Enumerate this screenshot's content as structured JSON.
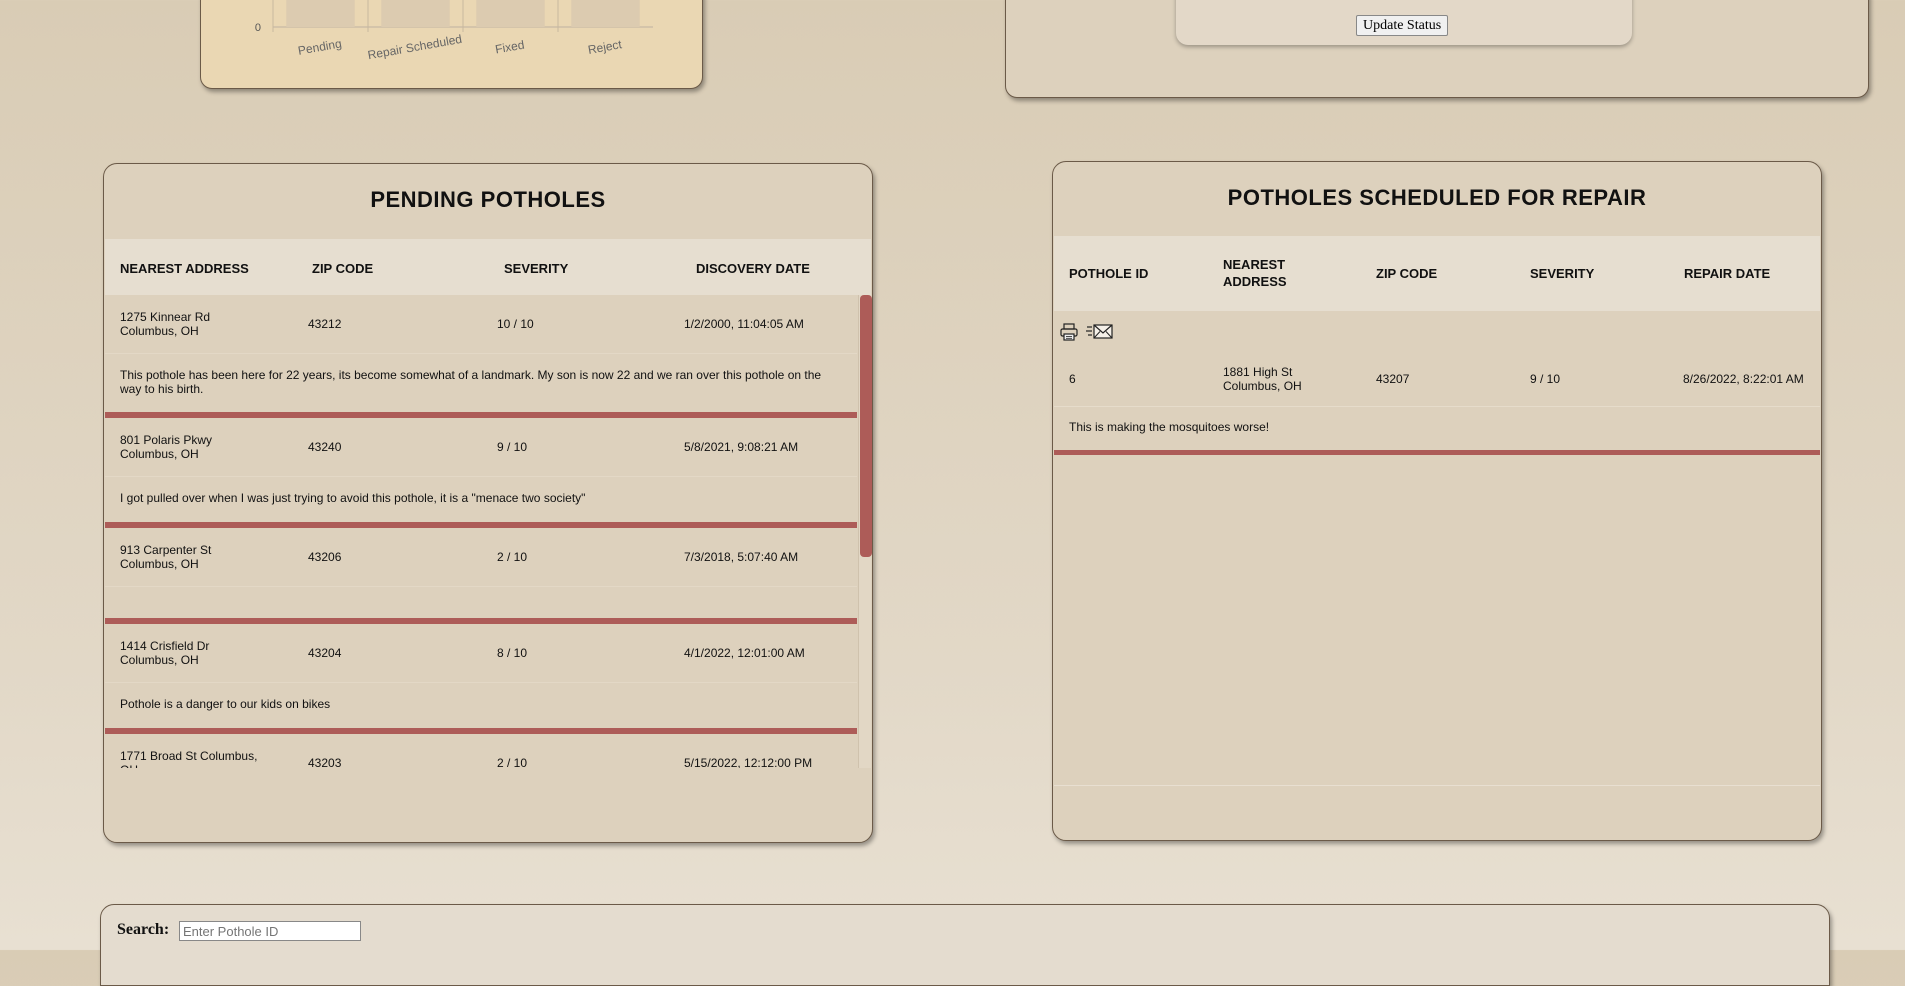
{
  "chart_data": {
    "type": "bar",
    "categories": [
      "Pending",
      "Repair Scheduled",
      "Fixed",
      "Reject"
    ],
    "ytick_labels": [
      "0"
    ]
  },
  "status_panel": {
    "update_button": "Update Status"
  },
  "pending": {
    "title": "PENDING POTHOLES",
    "columns": [
      "NEAREST ADDRESS",
      "ZIP CODE",
      "SEVERITY",
      "DISCOVERY DATE"
    ],
    "rows": [
      {
        "address_line1": "1275 Kinnear Rd",
        "address_line2": "Columbus, OH",
        "zip": "43212",
        "severity": "10 / 10",
        "date": "1/2/2000, 11:04:05 AM",
        "comment": "This pothole has been here for 22 years, its become somewhat of a landmark. My son is now 22 and we ran over this pothole on the way to his birth."
      },
      {
        "address_line1": "801 Polaris Pkwy",
        "address_line2": "Columbus, OH",
        "zip": "43240",
        "severity": "9 / 10",
        "date": "5/8/2021, 9:08:21 AM",
        "comment": "I got pulled over when I was just trying to avoid this pothole, it is a \"menace two society\""
      },
      {
        "address_line1": "913 Carpenter St",
        "address_line2": "Columbus, OH",
        "zip": "43206",
        "severity": "2 / 10",
        "date": "7/3/2018, 5:07:40 AM",
        "comment": ""
      },
      {
        "address_line1": "1414 Crisfield Dr",
        "address_line2": "Columbus, OH",
        "zip": "43204",
        "severity": "8 / 10",
        "date": "4/1/2022, 12:01:00 AM",
        "comment": "Pothole is a danger to our kids on bikes"
      },
      {
        "address_line1": "1771 Broad St Columbus,",
        "address_line2": "OH",
        "zip": "43203",
        "severity": "2 / 10",
        "date": "5/15/2022, 12:12:00 PM",
        "comment": ""
      }
    ]
  },
  "scheduled": {
    "title": "POTHOLES SCHEDULED FOR REPAIR",
    "columns": [
      "POTHOLE ID",
      "NEAREST ADDRESS",
      "ZIP CODE",
      "SEVERITY",
      "REPAIR DATE"
    ],
    "column_nearest_line1": "NEAREST",
    "column_nearest_line2": "ADDRESS",
    "rows": [
      {
        "id": "6",
        "address_line1": "1881 High St",
        "address_line2": "Columbus, OH",
        "zip": "43207",
        "severity": "9 / 10",
        "date": "8/26/2022, 8:22:01 AM",
        "comment": "This is making the mosquitoes worse!"
      }
    ],
    "icons": [
      "printer-icon",
      "email-icon"
    ]
  },
  "search": {
    "label": "Search:",
    "placeholder": "Enter Pothole ID",
    "value": ""
  }
}
